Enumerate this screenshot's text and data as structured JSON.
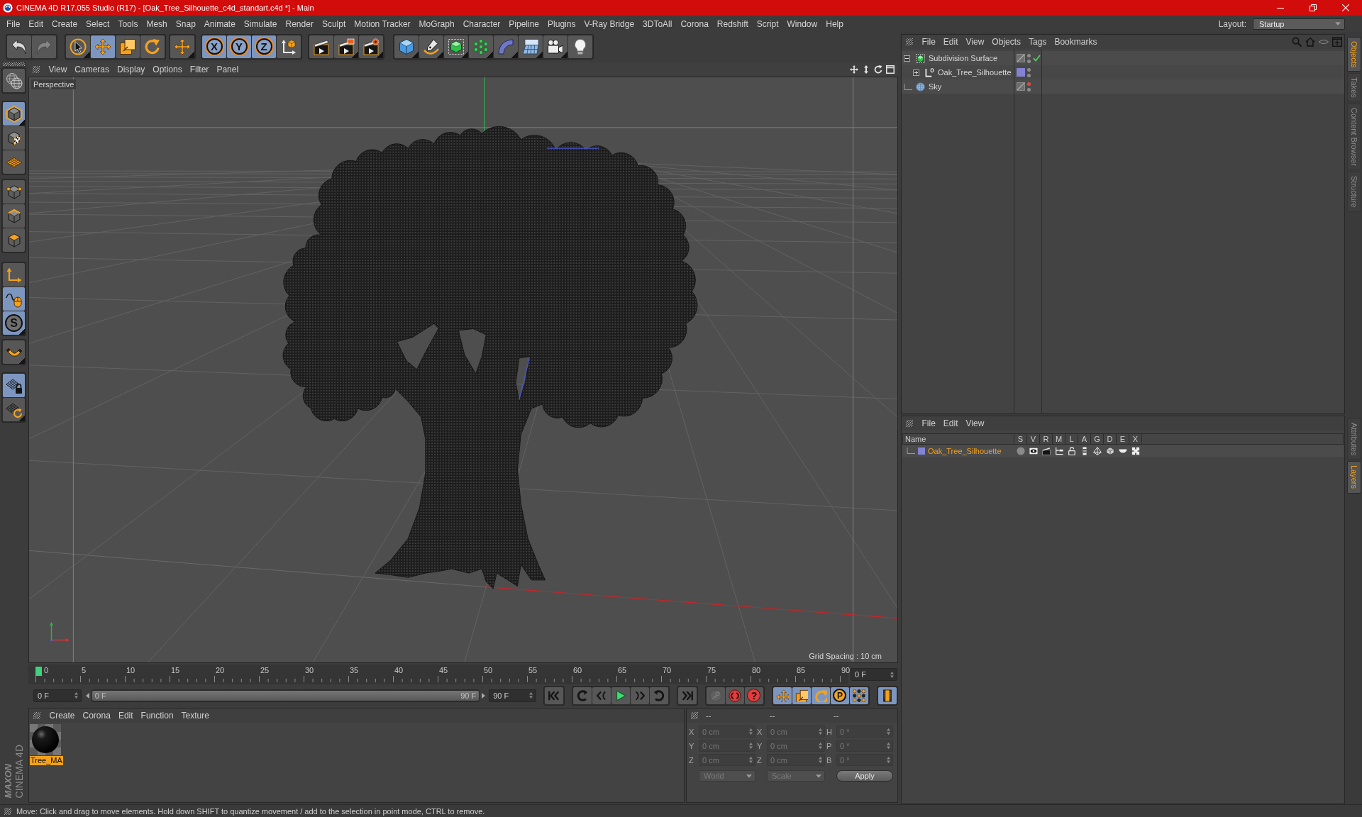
{
  "window": {
    "title": "CINEMA 4D R17.055 Studio (R17) - [Oak_Tree_Silhouette_c4d_standart.c4d *] - Main"
  },
  "menu_bar": {
    "items": [
      "File",
      "Edit",
      "Create",
      "Select",
      "Tools",
      "Mesh",
      "Snap",
      "Animate",
      "Simulate",
      "Render",
      "Sculpt",
      "Motion Tracker",
      "MoGraph",
      "Character",
      "Pipeline",
      "Plugins",
      "V-Ray Bridge",
      "3DToAll",
      "Corona",
      "Redshift",
      "Script",
      "Window",
      "Help"
    ],
    "layout_label": "Layout:",
    "layout_value": "Startup"
  },
  "toolbar": {
    "groups": [
      [
        {
          "on": false,
          "disabled": false
        },
        {
          "on": false,
          "disabled": true
        }
      ],
      [
        {
          "on": false,
          "disabled": false
        },
        {
          "on": true,
          "disabled": false
        },
        {
          "on": false,
          "disabled": false
        },
        {
          "on": false,
          "disabled": false
        }
      ],
      [
        {
          "on": false,
          "disabled": false
        }
      ],
      [
        {
          "label": "X",
          "on": true,
          "disabled": false
        },
        {
          "label": "Y",
          "on": true,
          "disabled": false
        },
        {
          "label": "Z",
          "on": true,
          "disabled": false
        },
        {
          "on": false,
          "disabled": false
        }
      ],
      [
        {
          "on": false,
          "disabled": false
        },
        {
          "on": false,
          "disabled": false
        },
        {
          "on": false,
          "disabled": false
        }
      ],
      [
        {
          "on": false,
          "disabled": false
        },
        {
          "on": false,
          "disabled": false
        },
        {
          "on": false,
          "disabled": false
        },
        {
          "on": false,
          "disabled": false
        },
        {
          "on": false,
          "disabled": false
        },
        {
          "on": false,
          "disabled": false
        },
        {
          "on": false,
          "disabled": false
        },
        {
          "on": false,
          "disabled": false
        }
      ]
    ]
  },
  "left_toolbar": {
    "groups": [
      [
        {
          "on": false
        }
      ],
      [
        {
          "on": true
        },
        {
          "on": false
        },
        {
          "on": false
        }
      ],
      [
        {
          "on": false
        },
        {
          "on": false
        },
        {
          "on": false
        }
      ],
      [
        {
          "on": false
        },
        {
          "on": true
        },
        {
          "label": "S",
          "on": true
        }
      ],
      [
        {
          "on": false
        }
      ],
      [
        {
          "on": true
        },
        {
          "on": false
        }
      ]
    ]
  },
  "viewport": {
    "menu": [
      "View",
      "Cameras",
      "Display",
      "Options",
      "Filter",
      "Panel"
    ],
    "camera_label": "Perspective",
    "grid_spacing": "Grid Spacing : 10 cm"
  },
  "timeline": {
    "ticks": [
      "0",
      "5",
      "10",
      "15",
      "20",
      "25",
      "30",
      "35",
      "40",
      "45",
      "50",
      "55",
      "60",
      "65",
      "70",
      "75",
      "80",
      "85",
      "90"
    ],
    "playhead": {
      "level": 0
    },
    "frame_field": "0 F"
  },
  "playback": {
    "start_field": "0 F",
    "range": {
      "start": "0 F",
      "end": "90 F",
      "level": 1
    },
    "end_field": "90 F",
    "buttons": [
      [
        {
          "on": false,
          "disabled": false
        }
      ],
      [
        {
          "on": false,
          "disabled": false
        },
        {
          "on": false,
          "disabled": false
        },
        {
          "on": false,
          "disabled": false
        },
        {
          "on": false,
          "disabled": false
        },
        {
          "on": false,
          "disabled": false
        }
      ],
      [
        {
          "on": false,
          "disabled": false
        }
      ],
      [
        {
          "on": false,
          "disabled": true
        },
        {
          "on": false,
          "disabled": false
        },
        {
          "label": "?",
          "on": false,
          "disabled": false
        }
      ],
      [
        {
          "on": true,
          "disabled": false
        },
        {
          "on": true,
          "disabled": false
        },
        {
          "on": true,
          "disabled": false
        },
        {
          "label": "P",
          "on": true,
          "disabled": false
        },
        {
          "on": true,
          "disabled": false
        }
      ],
      [
        {
          "on": true,
          "disabled": false
        }
      ]
    ]
  },
  "materials": {
    "menu": [
      "Create",
      "Corona",
      "Edit",
      "Function",
      "Texture"
    ],
    "items": [
      {
        "name": "Tree_MA",
        "selected": true
      }
    ]
  },
  "coordinates": {
    "headers": [
      "--",
      "--",
      "--"
    ],
    "rows": [
      [
        {
          "label": "X",
          "value": "0 cm"
        },
        {
          "label": "X",
          "value": "0 cm"
        },
        {
          "label": "H",
          "value": "0 °"
        }
      ],
      [
        {
          "label": "Y",
          "value": "0 cm"
        },
        {
          "label": "Y",
          "value": "0 cm"
        },
        {
          "label": "P",
          "value": "0 °"
        }
      ],
      [
        {
          "label": "Z",
          "value": "0 cm"
        },
        {
          "label": "Z",
          "value": "0 cm"
        },
        {
          "label": "B",
          "value": "0 °"
        }
      ]
    ],
    "dropdowns": [
      "World",
      "Scale"
    ],
    "apply_button": "Apply"
  },
  "branding": {
    "lines": [
      "MAXON",
      "CINEMA 4D"
    ]
  },
  "status_bar": {
    "text": "Move: Click and drag to move elements. Hold down SHIFT to quantize movement / add to the selection in point mode, CTRL to remove."
  },
  "object_manager": {
    "menu": [
      "File",
      "Edit",
      "View",
      "Objects",
      "Tags",
      "Bookmarks"
    ],
    "objects": [
      {
        "name": "Subdivision Surface",
        "kind": "subdivision",
        "expanded": true,
        "editor_hidden": false,
        "render_hidden": false,
        "enabled": true,
        "children": [
          {
            "name": "Oak_Tree_Silhouette",
            "kind": "polygon",
            "expanded": false,
            "color": "#8383d4",
            "editor_hidden": false,
            "render_hidden": false,
            "enabled": false
          }
        ]
      },
      {
        "name": "Sky",
        "kind": "sky",
        "editor_hidden": true,
        "render_hidden": false,
        "enabled": false
      }
    ]
  },
  "layer_manager": {
    "menu": [
      "File",
      "Edit",
      "View"
    ],
    "columns": [
      "Name",
      "S",
      "V",
      "R",
      "M",
      "L",
      "A",
      "G",
      "D",
      "E",
      "X"
    ],
    "layers": [
      {
        "name": "Oak_Tree_Silhouette",
        "color": "#8383d4",
        "selected": true,
        "flags": [
          {
            "on": false
          },
          {
            "on": true
          },
          {
            "on": true
          },
          {
            "on": true
          },
          {
            "on": false
          },
          {
            "on": true
          },
          {
            "on": true
          },
          {
            "on": true
          },
          {
            "on": true
          },
          {
            "on": true
          }
        ]
      }
    ]
  },
  "side_tabs": {
    "top": [
      {
        "label": "Objects",
        "selected": true
      },
      {
        "label": "Takes",
        "selected": false
      },
      {
        "label": "Content Browser",
        "selected": false
      },
      {
        "label": "Structure",
        "selected": false
      }
    ],
    "bottom": [
      {
        "label": "Attributes",
        "selected": false
      },
      {
        "label": "Layers",
        "selected": true
      }
    ]
  }
}
